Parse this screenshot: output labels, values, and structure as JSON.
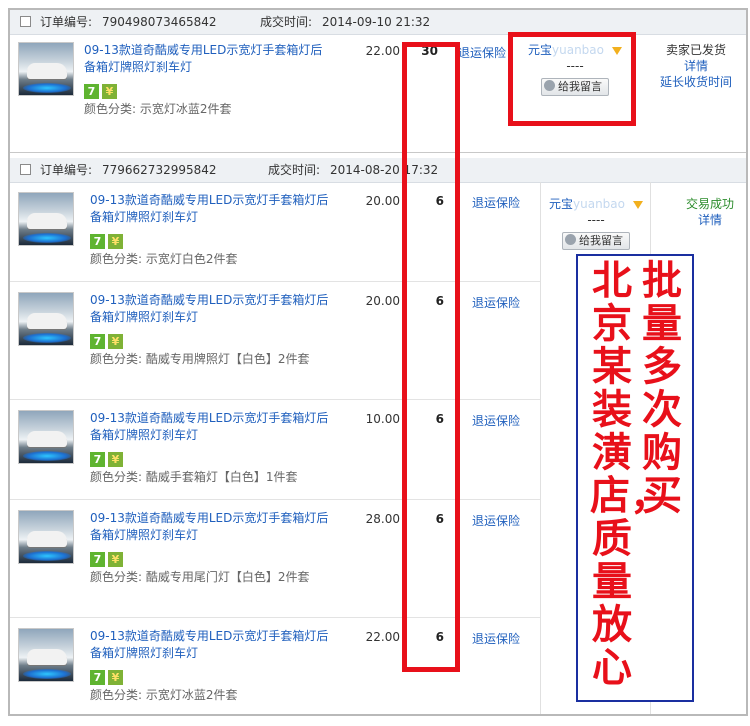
{
  "order1": {
    "order_no_label": "订单编号:",
    "order_no": "790498073465842",
    "deal_time_label": "成交时间:",
    "deal_time": "2014-09-10 21:32",
    "item": {
      "title": "09-13款道奇酷威专用LED示宽灯手套箱灯后备箱灯牌照灯刹车灯",
      "sku": "颜色分类: 示宽灯冰蓝2件套",
      "price": "22.00",
      "qty": "30",
      "service": "退运保险"
    },
    "seller_name": "元宝",
    "seller_name_hidden": "yuanbao",
    "seller_dash": "----",
    "message_button": "给我留言",
    "status": "卖家已发货",
    "detail_link": "详情",
    "extend_link": "延长收货时间"
  },
  "order2": {
    "order_no_label": "订单编号:",
    "order_no": "779662732995842",
    "deal_time_label": "成交时间:",
    "deal_time": "2014-08-20 17:32",
    "seller_name": "元宝",
    "seller_name_hidden": "yuanbao",
    "seller_dash": "----",
    "message_button": "给我留言",
    "status": "交易成功",
    "detail_link": "详情",
    "items": [
      {
        "title": "09-13款道奇酷威专用LED示宽灯手套箱灯后备箱灯牌照灯刹车灯",
        "sku": "颜色分类: 示宽灯白色2件套",
        "price": "20.00",
        "qty": "6",
        "service": "退运保险"
      },
      {
        "title": "09-13款道奇酷威专用LED示宽灯手套箱灯后备箱灯牌照灯刹车灯",
        "sku": "颜色分类: 酷威专用牌照灯【白色】2件套",
        "price": "20.00",
        "qty": "6",
        "service": "退运保险"
      },
      {
        "title": "09-13款道奇酷威专用LED示宽灯手套箱灯后备箱灯牌照灯刹车灯",
        "sku": "颜色分类: 酷威手套箱灯【白色】1件套",
        "price": "10.00",
        "qty": "6",
        "service": "退运保险"
      },
      {
        "title": "09-13款道奇酷威专用LED示宽灯手套箱灯后备箱灯牌照灯刹车灯",
        "sku": "颜色分类: 酷威专用尾门灯【白色】2件套",
        "price": "28.00",
        "qty": "6",
        "service": "退运保险"
      },
      {
        "title": "09-13款道奇酷威专用LED示宽灯手套箱灯后备箱灯牌照灯刹车灯",
        "sku": "颜色分类: 示宽灯冰蓝2件套",
        "price": "22.00",
        "qty": "6",
        "service": "退运保险"
      }
    ]
  },
  "badges": {
    "seven": "7",
    "coin": "¥"
  },
  "annotation": {
    "col1": "北京某装潢店，质量放心",
    "col2": "批量多次购买"
  },
  "colors": {
    "link": "#1f5fbd",
    "annotation_red": "#e8101a",
    "annotation_blue": "#1a2fa0"
  }
}
